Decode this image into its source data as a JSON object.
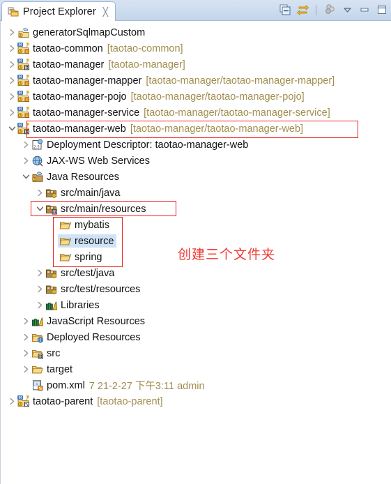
{
  "window": {
    "tab": {
      "title": "Project Explorer",
      "icon": "project-explorer-icon",
      "close_glyph": "╳"
    },
    "toolbar": [
      {
        "name": "collapse-all-icon",
        "title": "Collapse All"
      },
      {
        "name": "link-with-editor-icon",
        "title": "Link with Editor"
      },
      {
        "name": "view-menu-filter-icon",
        "title": "View Menu"
      },
      {
        "name": "chevron-down-icon",
        "title": "View Menu"
      },
      {
        "name": "minimize-icon",
        "title": "Minimize"
      },
      {
        "name": "maximize-icon",
        "title": "Maximize"
      }
    ]
  },
  "annotation": {
    "text": "创建三个文件夹",
    "color": "#ef3b33"
  },
  "tree": [
    {
      "indent": 0,
      "twisty": "collapsed",
      "icon": "maven-generator-icon",
      "label": "generatorSqlmapCustom",
      "meta": ""
    },
    {
      "indent": 0,
      "twisty": "collapsed",
      "icon": "maven-project-icon",
      "label": "taotao-common",
      "meta": "[taotao-common]"
    },
    {
      "indent": 0,
      "twisty": "collapsed",
      "icon": "maven-project-pom-icon",
      "label": "taotao-manager",
      "meta": "[taotao-manager]"
    },
    {
      "indent": 0,
      "twisty": "collapsed",
      "icon": "maven-project-icon",
      "label": "taotao-manager-mapper",
      "meta": "[taotao-manager/taotao-manager-mapper]"
    },
    {
      "indent": 0,
      "twisty": "collapsed",
      "icon": "maven-project-icon",
      "label": "taotao-manager-pojo",
      "meta": "[taotao-manager/taotao-manager-pojo]"
    },
    {
      "indent": 0,
      "twisty": "collapsed",
      "icon": "maven-project-icon",
      "label": "taotao-manager-service",
      "meta": "[taotao-manager/taotao-manager-service]"
    },
    {
      "indent": 0,
      "twisty": "expanded",
      "icon": "maven-project-web-icon",
      "label": "taotao-manager-web",
      "meta": "[taotao-manager/taotao-manager-web]"
    },
    {
      "indent": 1,
      "twisty": "collapsed",
      "icon": "deployment-descriptor-icon",
      "label": "Deployment Descriptor: taotao-manager-web",
      "meta": ""
    },
    {
      "indent": 1,
      "twisty": "collapsed",
      "icon": "jaxws-icon",
      "label": "JAX-WS Web Services",
      "meta": ""
    },
    {
      "indent": 1,
      "twisty": "expanded",
      "icon": "java-resources-icon",
      "label": "Java Resources",
      "meta": ""
    },
    {
      "indent": 2,
      "twisty": "collapsed",
      "icon": "source-folder-icon",
      "label": "src/main/java",
      "meta": ""
    },
    {
      "indent": 2,
      "twisty": "expanded",
      "icon": "source-folder-web-icon",
      "label": "src/main/resources",
      "meta": ""
    },
    {
      "indent": 3,
      "twisty": "none",
      "icon": "folder-question-icon",
      "label": "mybatis",
      "meta": ""
    },
    {
      "indent": 3,
      "twisty": "none",
      "icon": "folder-question-icon",
      "label": "resource",
      "meta": "",
      "selected": true
    },
    {
      "indent": 3,
      "twisty": "none",
      "icon": "folder-question-icon",
      "label": "spring",
      "meta": ""
    },
    {
      "indent": 2,
      "twisty": "collapsed",
      "icon": "source-folder-icon",
      "label": "src/test/java",
      "meta": ""
    },
    {
      "indent": 2,
      "twisty": "collapsed",
      "icon": "source-folder-icon",
      "label": "src/test/resources",
      "meta": ""
    },
    {
      "indent": 2,
      "twisty": "collapsed",
      "icon": "libraries-icon",
      "label": "Libraries",
      "meta": ""
    },
    {
      "indent": 1,
      "twisty": "collapsed",
      "icon": "libraries-icon",
      "label": "JavaScript Resources",
      "meta": ""
    },
    {
      "indent": 1,
      "twisty": "collapsed",
      "icon": "deployed-resources-icon",
      "label": "Deployed Resources",
      "meta": ""
    },
    {
      "indent": 1,
      "twisty": "collapsed",
      "icon": "folder-web-icon",
      "label": "src",
      "meta": ""
    },
    {
      "indent": 1,
      "twisty": "collapsed",
      "icon": "folder-open-icon",
      "label": "target",
      "meta": ""
    },
    {
      "indent": 1,
      "twisty": "none",
      "icon": "xml-file-icon",
      "label": "pom.xml",
      "meta": "7  21-2-27 下午3:11  admin"
    },
    {
      "indent": 0,
      "twisty": "collapsed",
      "icon": "maven-parent-icon",
      "label": "taotao-parent",
      "meta": "[taotao-parent]"
    }
  ]
}
